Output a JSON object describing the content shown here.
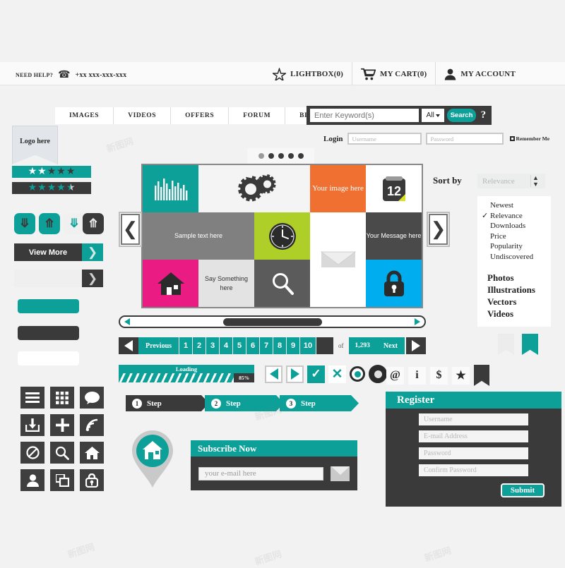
{
  "header": {
    "need_help_label": "NEED HELP?",
    "phone_icon": "phone-icon",
    "phone_number": "+xx xxx-xxx-xxx",
    "utilities": [
      {
        "icon": "star-icon",
        "label": "LIGHTBOX(0)"
      },
      {
        "icon": "cart-icon",
        "label": "MY CART(0)"
      },
      {
        "icon": "user-icon",
        "label": "MY ACCOUNT"
      }
    ]
  },
  "nav": {
    "items": [
      {
        "label": "IMAGES"
      },
      {
        "label": "VIDEOS"
      },
      {
        "label": "OFFERS"
      },
      {
        "label": "FORUM"
      },
      {
        "label": "BLOG"
      }
    ]
  },
  "logo": {
    "text": "Logo here"
  },
  "search": {
    "placeholder": "Enter Keyword(s)",
    "value": "",
    "scope_value": "All",
    "button_label": "Search",
    "help_label": "?"
  },
  "login": {
    "label": "Login",
    "username_placeholder": "Username",
    "password_placeholder": "Password",
    "remember_label": "Remember Me"
  },
  "carousel": {
    "dot_count": 5,
    "active_index": 0,
    "prev_icon": "chevron-left-icon",
    "next_icon": "chevron-right-icon"
  },
  "tiles": [
    {
      "name": "chart-tile",
      "style": "t-teal",
      "icon": "bar-chart-icon",
      "text": ""
    },
    {
      "name": "settings-tile",
      "style": "t-white",
      "icon": "gears-icon",
      "text": ""
    },
    {
      "name": "image-tile",
      "style": "t-orange",
      "icon": "",
      "text": "Your image here"
    },
    {
      "name": "calendar-tile",
      "style": "t-img",
      "icon": "calendar-icon",
      "text": ""
    },
    {
      "name": "sample-text-tile",
      "style": "t-gray",
      "icon": "",
      "text": "Sample text here"
    },
    {
      "name": "clock-tile",
      "style": "t-green",
      "icon": "clock-icon",
      "text": ""
    },
    {
      "name": "mail-tile",
      "style": "t-pure",
      "icon": "envelope-icon",
      "text": ""
    },
    {
      "name": "message-tile",
      "style": "t-dark",
      "icon": "",
      "text": "Your Message here"
    },
    {
      "name": "home-tile",
      "style": "t-pink",
      "icon": "home-icon",
      "text": ""
    },
    {
      "name": "say-something-tile",
      "style": "t-ltgray",
      "icon": "",
      "text": "Say Something here"
    },
    {
      "name": "search-tile",
      "style": "t-midgray",
      "icon": "magnifier-icon",
      "text": ""
    },
    {
      "name": "lock-tile",
      "style": "t-blue",
      "icon": "lock-icon",
      "text": ""
    }
  ],
  "sort": {
    "label": "Sort by",
    "selected": "Relevance",
    "options": [
      "Newest",
      "Relevance",
      "Downloads",
      "Price",
      "Popularity",
      "Undiscovered"
    ],
    "checked": "Relevance"
  },
  "categories": [
    "Photos",
    "Illustrations",
    "Vectors",
    "Videos"
  ],
  "ratings": {
    "top": {
      "filled": 2,
      "total": 5,
      "bg": "#0da099"
    },
    "bottom": {
      "filled": 4.5,
      "total": 5,
      "bg": "#3a3a3a"
    }
  },
  "buttons": {
    "view_more_label": "View More",
    "arrow_icon": "chevron-right-icon",
    "chevrons": [
      "chevron-double-down-icon",
      "chevron-double-up-icon",
      "chevron-double-down-icon",
      "chevron-double-up-icon"
    ]
  },
  "scrollbar": {
    "left_icon": "triangle-left-icon",
    "right_icon": "triangle-right-icon"
  },
  "pagination": {
    "previous_label": "Previous",
    "next_label": "Next",
    "pages": [
      "1",
      "2",
      "3",
      "4",
      "5",
      "6",
      "7",
      "8",
      "9",
      "10"
    ],
    "active_page": "1",
    "of_label": "of",
    "total_pages": "1,293"
  },
  "loading": {
    "label": "Loading",
    "percent": "85%",
    "value": 85
  },
  "media_buttons": [
    {
      "name": "play-back-button",
      "icon": "triangle-left-icon"
    },
    {
      "name": "play-forward-button",
      "icon": "triangle-right-icon"
    },
    {
      "name": "accept-button",
      "icon": "check-icon",
      "glyph": "✓"
    },
    {
      "name": "reject-button",
      "icon": "cross-icon",
      "glyph": "✕"
    },
    {
      "name": "radio-on-button",
      "icon": "radio-selected-icon"
    },
    {
      "name": "radio-dark-button",
      "icon": "radio-dark-icon"
    }
  ],
  "social_buttons": [
    {
      "name": "at-button",
      "glyph": "@"
    },
    {
      "name": "info-button",
      "glyph": "i"
    },
    {
      "name": "dollar-button",
      "glyph": "$"
    },
    {
      "name": "star-button",
      "glyph": "★"
    }
  ],
  "icon_grid": [
    "menu-icon",
    "grid-icon",
    "chat-icon",
    "download-icon",
    "plus-icon",
    "rss-icon",
    "block-icon",
    "search-icon",
    "home-icon",
    "user-icon",
    "windows-icon",
    "lock-keyhole-icon"
  ],
  "steps": [
    {
      "num": "1",
      "label": "Step",
      "state": "dark"
    },
    {
      "num": "2",
      "label": "Step",
      "state": "teal"
    },
    {
      "num": "3",
      "label": "Step",
      "state": "teal"
    }
  ],
  "map_pin": {
    "icon": "home-pin-icon"
  },
  "subscribe": {
    "title": "Subscribe Now",
    "email_placeholder": "your e-mail here",
    "send_icon": "envelope-icon"
  },
  "register": {
    "title": "Register",
    "fields": [
      "Username",
      "E-mail Address",
      "Password",
      "Confirm Password"
    ],
    "submit_label": "Submit"
  },
  "colors": {
    "teal": "#0da099",
    "dark": "#3a3a3a",
    "orange": "#f07032",
    "green": "#aece28",
    "pink": "#ea1b82",
    "blue": "#00aeef",
    "page_bg": "#f2f2f2"
  },
  "watermarks": [
    "新图网",
    "新图网",
    "新图网",
    "新图网",
    "新图网"
  ]
}
